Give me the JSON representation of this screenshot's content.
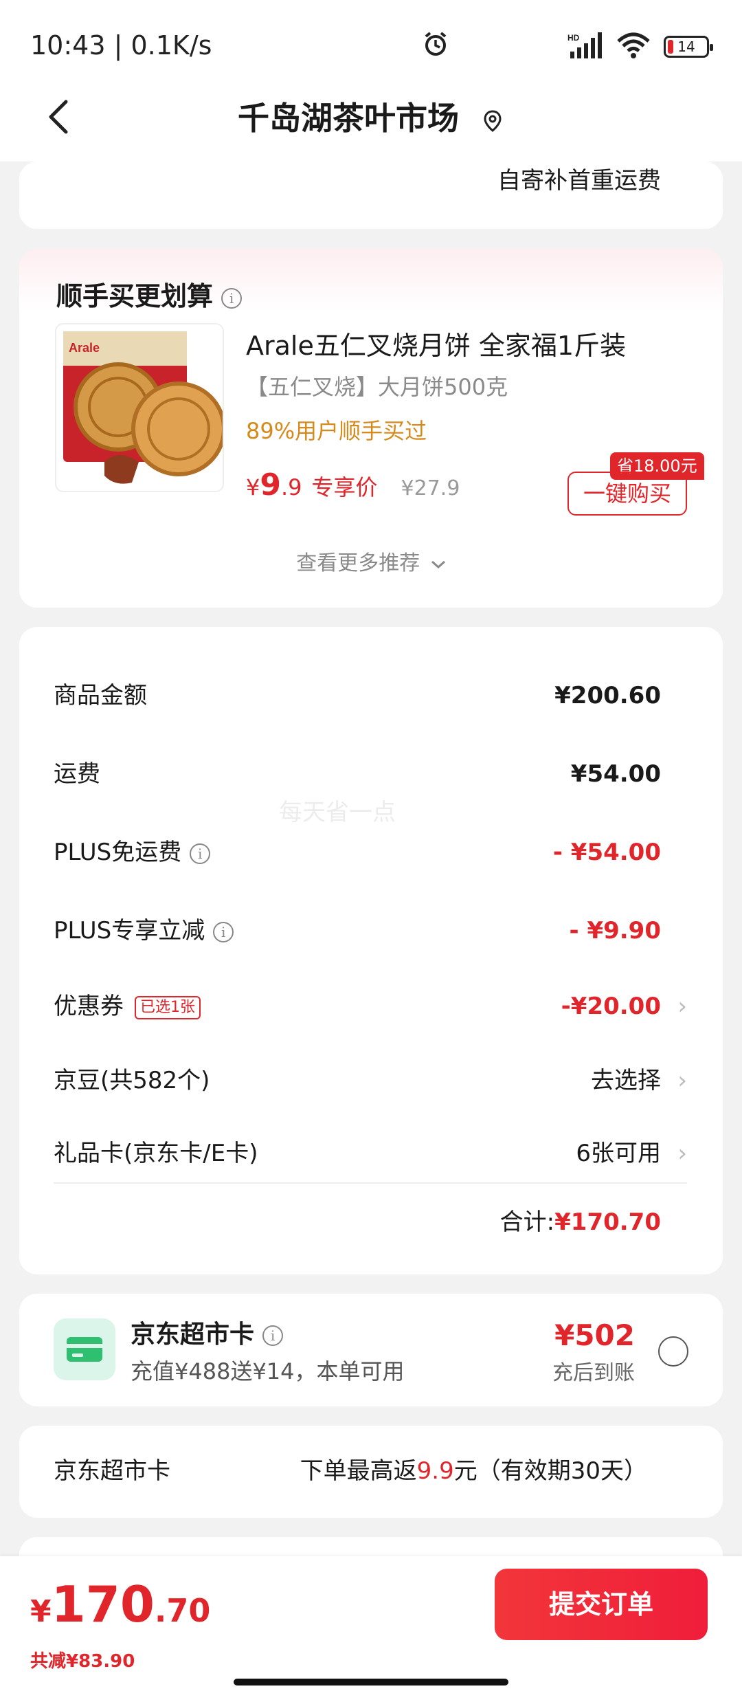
{
  "status": {
    "time": "10:43 | 0.1K/s",
    "network": "HD",
    "battery": "14"
  },
  "nav": {
    "title": "千岛湖茶叶市场"
  },
  "top_card": {
    "right_text": "自寄补首重运费"
  },
  "reco": {
    "title": "顺手买更划算",
    "product_name": "Arale五仁叉烧月饼 全家福1斤装",
    "product_sub": "【五仁叉烧】大月饼500克",
    "ratio": "89%用户顺手买过",
    "price_currency": "¥",
    "price_int": "9",
    "price_dec": ".9",
    "price_tag": "专享价",
    "orig_price": "¥27.9",
    "save_badge": "省18.00元",
    "buy_label": "一键购买",
    "more_label": "查看更多推荐",
    "image_label": "Arale"
  },
  "summary": {
    "watermark": "每天省一点",
    "rows": [
      {
        "label": "商品金额",
        "value": "¥200.60"
      },
      {
        "label": "运费",
        "value": "¥54.00"
      },
      {
        "label": "PLUS免运费",
        "value": "- ¥54.00"
      },
      {
        "label": "PLUS专享立减",
        "value": "- ¥9.90"
      },
      {
        "label": "优惠券",
        "tag": "已选1张",
        "value": "-¥20.00"
      },
      {
        "label": "京豆(共582个)",
        "value": "去选择"
      },
      {
        "label": "礼品卡(京东卡/E卡)",
        "value": "6张可用"
      }
    ],
    "total_label": "合计:",
    "total_value": "¥170.70"
  },
  "market_card": {
    "title": "京东超市卡",
    "desc": "充值¥488送¥14，本单可用",
    "price": "¥502",
    "sub": "充后到账"
  },
  "return_card": {
    "label": "京东超市卡",
    "value_prefix": "下单最高返",
    "value_highlight": "9.9",
    "value_suffix": "元（有效期30天）"
  },
  "bottom": {
    "currency": "¥",
    "price_int": "170",
    "price_dec": ".70",
    "reduce": "共减¥83.90",
    "submit_label": "提交订单"
  },
  "colors": {
    "accent": "#e0262b",
    "orange": "#d68a1c",
    "green": "#2fbf71"
  }
}
